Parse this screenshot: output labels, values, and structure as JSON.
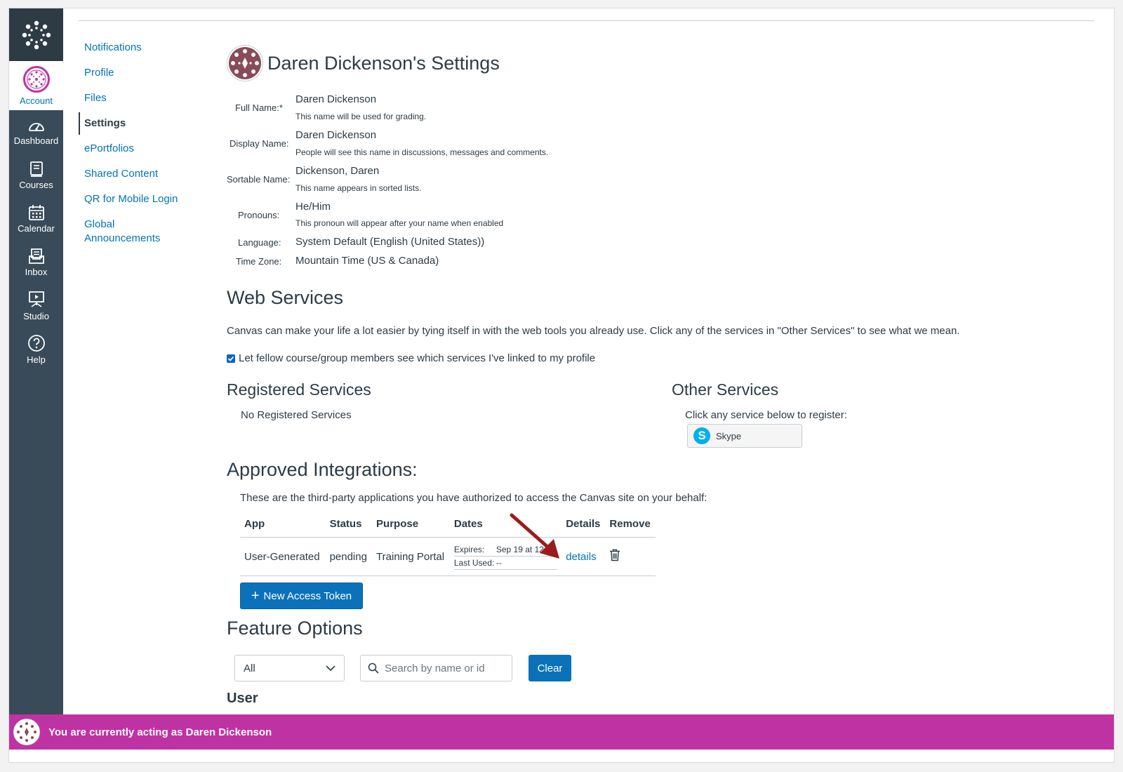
{
  "global_nav": {
    "account_label": "Account",
    "items": [
      {
        "label": "Dashboard",
        "icon": "dashboard-icon"
      },
      {
        "label": "Courses",
        "icon": "courses-icon"
      },
      {
        "label": "Calendar",
        "icon": "calendar-icon"
      },
      {
        "label": "Inbox",
        "icon": "inbox-icon"
      },
      {
        "label": "Studio",
        "icon": "studio-icon"
      },
      {
        "label": "Help",
        "icon": "help-icon"
      }
    ],
    "colors": {
      "nav_bg": "#394b58",
      "logo_bg": "#2d3b45",
      "active_text": "#0374b5"
    }
  },
  "sub_nav": {
    "items": [
      {
        "label": "Notifications"
      },
      {
        "label": "Profile"
      },
      {
        "label": "Files"
      },
      {
        "label": "Settings",
        "active": true
      },
      {
        "label": "ePortfolios"
      },
      {
        "label": "Shared Content"
      },
      {
        "label": "QR for Mobile Login"
      },
      {
        "label": "Global Announcements"
      }
    ]
  },
  "settings": {
    "title": "Daren Dickenson's Settings",
    "fields": [
      {
        "label": "Full Name:*",
        "value": "Daren Dickenson",
        "hint": "This name will be used for grading."
      },
      {
        "label": "Display Name:",
        "value": "Daren Dickenson",
        "hint": "People will see this name in discussions, messages and comments."
      },
      {
        "label": "Sortable Name:",
        "value": "Dickenson, Daren",
        "hint": "This name appears in sorted lists."
      },
      {
        "label": "Pronouns:",
        "value": "He/Him",
        "hint": "This pronoun will appear after your name when enabled"
      },
      {
        "label": "Language:",
        "value": "System Default (English (United States))"
      },
      {
        "label": "Time Zone:",
        "value": "Mountain Time (US & Canada)"
      }
    ]
  },
  "web_services": {
    "heading": "Web Services",
    "description": "Canvas can make your life a lot easier by tying itself in with the web tools you already use. Click any of the services in \"Other Services\" to see what we mean.",
    "checkbox_label": "Let fellow course/group members see which services I've linked to my profile",
    "checkbox_checked": true,
    "registered_heading": "Registered Services",
    "registered_empty": "No Registered Services",
    "other_heading": "Other Services",
    "other_prompt": "Click any service below to register:",
    "other_services": [
      {
        "label": "Skype",
        "icon": "skype-icon"
      }
    ]
  },
  "approved_integrations": {
    "heading": "Approved Integrations:",
    "description": "These are the third-party applications you have authorized to access the Canvas site on your behalf:",
    "columns": [
      "App",
      "Status",
      "Purpose",
      "Dates",
      "Details",
      "Remove"
    ],
    "rows": [
      {
        "app": "User-Generated",
        "status": "pending",
        "purpose": "Training Portal",
        "expires_label": "Expires:",
        "expires_value": "Sep 19 at 12am",
        "last_used_label": "Last Used:",
        "last_used_value": "--",
        "details_link": "details"
      }
    ],
    "new_token_button": "New Access Token"
  },
  "feature_options": {
    "heading": "Feature Options",
    "filter_selected": "All",
    "search_placeholder": "Search by name or id",
    "clear_button": "Clear",
    "section_heading": "User"
  },
  "banner": {
    "text": "You are currently acting as Daren Dickenson",
    "color": "#bf32a4"
  }
}
